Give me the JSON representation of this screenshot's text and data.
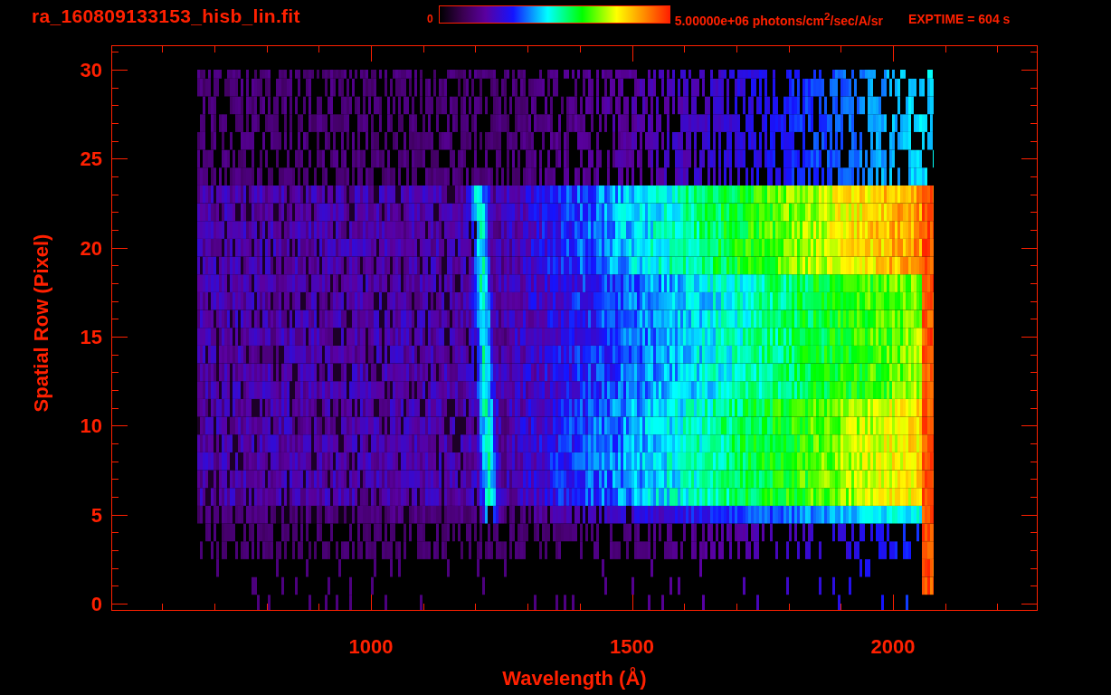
{
  "title": "ra_160809133153_hisb_lin.fit",
  "colorbar": {
    "min_label": "0",
    "max_label": "5.00000e+06 photons/cm$^{2}$/sec/A/sr"
  },
  "exposure": "EXPTIME = 604 s",
  "y_axis": {
    "title": "Spatial Row (Pixel)",
    "tick_labels": [
      "30",
      "25",
      "20",
      "15",
      "10",
      "5",
      "0"
    ]
  },
  "x_axis": {
    "title": "Wavelength (Å)",
    "tick_labels": [
      "1000",
      "1500",
      "2000"
    ]
  }
}
